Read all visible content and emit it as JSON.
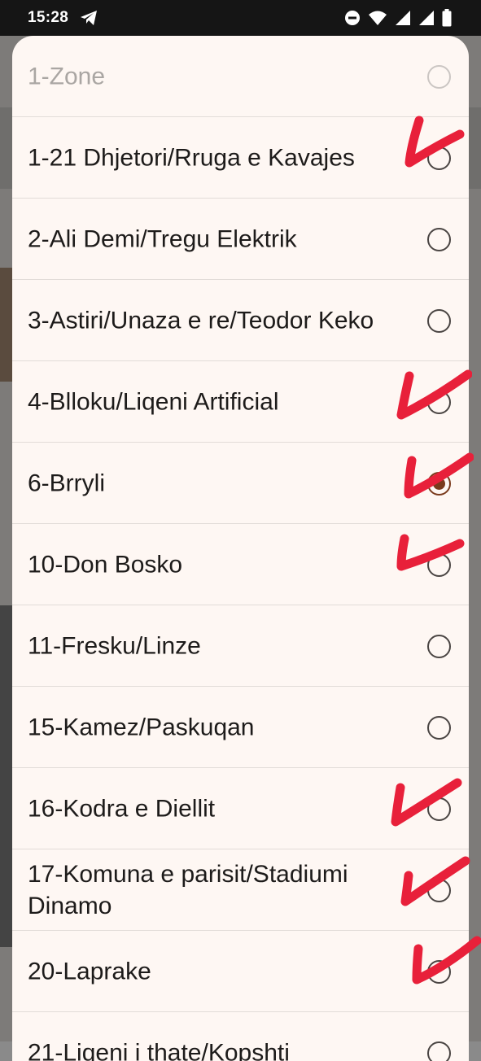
{
  "status_bar": {
    "time": "15:28",
    "icons": [
      "telegram-icon",
      "do-not-disturb-icon",
      "wifi-icon",
      "signal-icon",
      "signal-icon",
      "battery-icon"
    ]
  },
  "dialog": {
    "header": "1-Zone",
    "options": [
      {
        "label": "1-21 Dhjetori/Rruga e Kavajes",
        "checked": false
      },
      {
        "label": "2-Ali Demi/Tregu Elektrik",
        "checked": false
      },
      {
        "label": "3-Astiri/Unaza e re/Teodor Keko",
        "checked": false
      },
      {
        "label": "4-Blloku/Liqeni Artificial",
        "checked": false
      },
      {
        "label": "6-Brryli",
        "checked": true
      },
      {
        "label": "10-Don Bosko",
        "checked": false
      },
      {
        "label": "11-Fresku/Linze",
        "checked": false
      },
      {
        "label": "15-Kamez/Paskuqan",
        "checked": false
      },
      {
        "label": "16-Kodra e Diellit",
        "checked": false
      },
      {
        "label": "17-Komuna e parisit/Stadiumi Dinamo",
        "checked": false
      },
      {
        "label": "20-Laprake",
        "checked": false
      },
      {
        "label": "21-Liqeni i thate/Kopshti",
        "checked": false
      }
    ]
  },
  "annotation_color": "#e8203a",
  "accent_color": "#7a3a1c"
}
